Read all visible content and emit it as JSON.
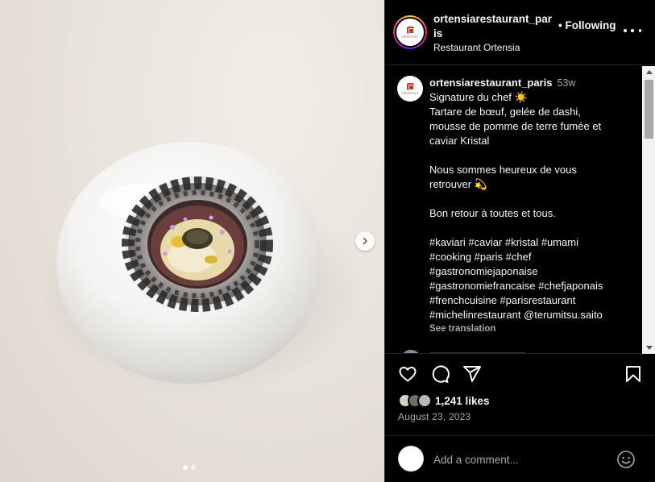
{
  "photo": {
    "carousel_index": 1,
    "carousel_total": 2,
    "next_icon": "chevron-right-icon"
  },
  "header": {
    "username": "ortensiarestaurant_paris",
    "separator": "•",
    "follow_status": "Following",
    "subtitle": "Restaurant Ortensia",
    "more_icon": "more-horizontal-icon",
    "logo_text": "ORTENSIA"
  },
  "caption": {
    "username": "ortensiarestaurant_paris",
    "time": "53w",
    "lines": [
      "Signature du chef ☀️",
      "Tartare de bœuf, gelée de dashi,",
      "mousse de pomme de terre fumée et",
      "caviar Kristal",
      "",
      "Nous sommes heureux de vous",
      "retrouver 💫",
      "",
      "Bon retour à toutes et tous.",
      "",
      "#kaviari #caviar #kristal #umami",
      "#cooking #paris #chef",
      "#gastronomiejaponaise",
      "#gastronomiefrancaise #chefjaponais",
      "#frenchcuisine #parisrestaurant",
      "#michelinrestaurant @terumitsu.saito"
    ],
    "see_translation": "See translation"
  },
  "actions": {
    "like_icon": "heart-icon",
    "comment_icon": "comment-icon",
    "share_icon": "share-icon",
    "save_icon": "bookmark-icon"
  },
  "likes": {
    "count_text": "1,241 likes"
  },
  "date": "August 23, 2023",
  "comment_bar": {
    "placeholder": "Add a comment...",
    "emoji_icon": "emoji-icon"
  },
  "colors": {
    "background": "#000000",
    "text": "#f5f5f5",
    "muted": "#a8a8a8",
    "divider": "#262626"
  }
}
